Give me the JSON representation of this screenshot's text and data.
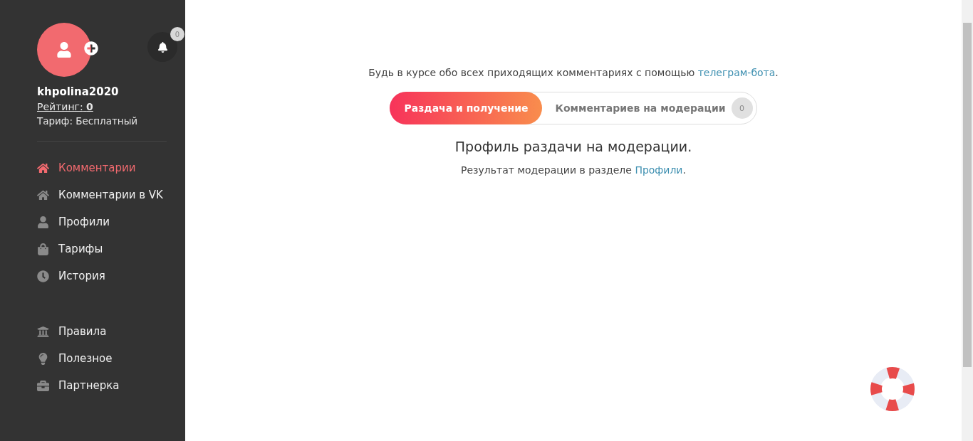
{
  "profile": {
    "username": "khpolina2020",
    "rating_label": "Рейтинг:",
    "rating_value": "0",
    "plan": "Тариф: Бесплатный",
    "notifications": "0"
  },
  "nav": [
    {
      "items": [
        {
          "label": "Комментарии",
          "selected": true
        },
        {
          "label": "Комментарии в VK",
          "selected": false
        },
        {
          "label": "Профили",
          "selected": false
        },
        {
          "label": "Тарифы",
          "selected": false
        },
        {
          "label": "История",
          "selected": false
        }
      ]
    },
    {
      "items": [
        {
          "label": "Правила",
          "selected": false
        },
        {
          "label": "Полезное",
          "selected": false
        },
        {
          "label": "Партнерка",
          "selected": false
        }
      ]
    }
  ],
  "notice": {
    "text": "Будь в курсе обо всех приходящих комментариях с помощью",
    "link": "телеграм-бота",
    "end": "."
  },
  "tabs": [
    {
      "label": "Раздача и получение",
      "selected": true
    },
    {
      "label": "Комментариев на модерации",
      "selected": false,
      "badge": "0"
    }
  ],
  "status": {
    "title": "Профиль раздачи на модерации.",
    "text": "Результат модерации в разделе",
    "link": "Профили",
    "end": "."
  }
}
